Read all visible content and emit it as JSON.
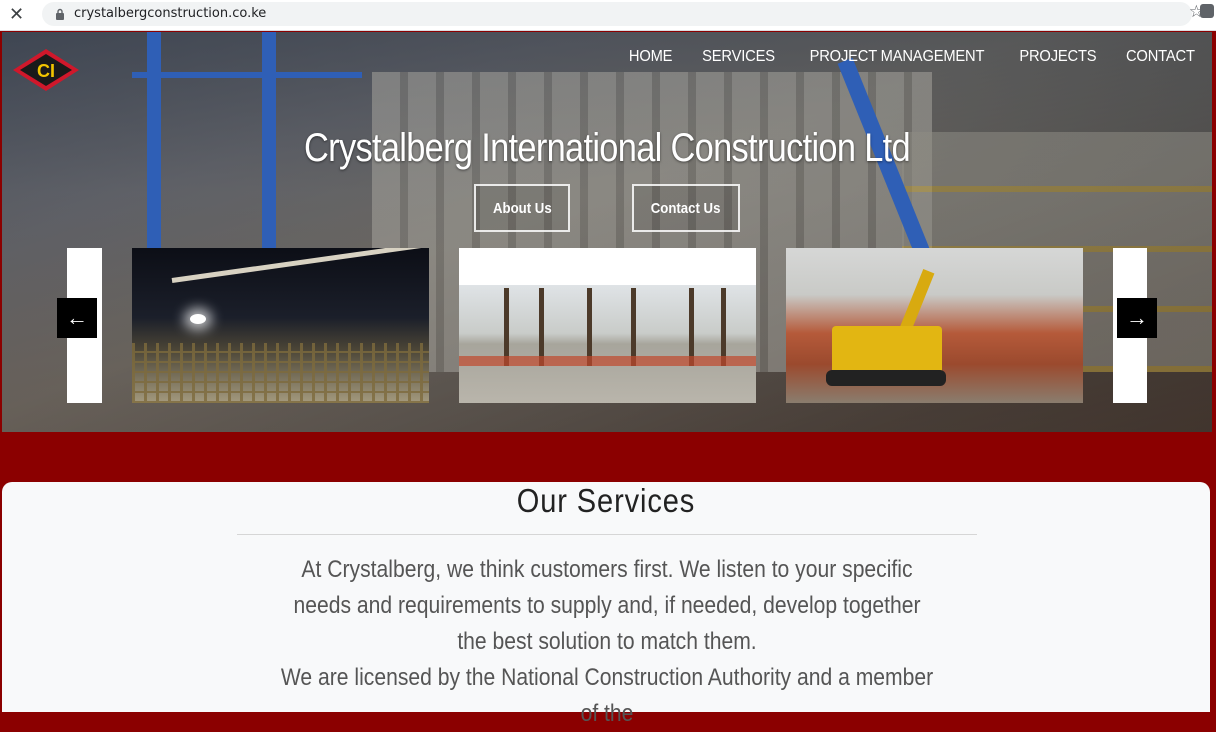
{
  "browser": {
    "url": "crystalbergconstruction.co.ke",
    "close_icon": "close-icon",
    "lock_icon": "lock-icon",
    "star_icon": "star-icon",
    "extension_icon": "puzzle-icon"
  },
  "site": {
    "logo_text": "CI",
    "nav": [
      "HOME",
      "SERVICES",
      "PROJECT MANAGEMENT",
      "PROJECTS",
      "CONTACT"
    ]
  },
  "hero": {
    "title": "Crystalberg International Construction Ltd",
    "about_label": "About Us",
    "contact_label": "Contact Us",
    "prev_arrow": "←",
    "next_arrow": "→"
  },
  "services": {
    "title": "Our Services",
    "paragraph1": "At Crystalberg, we think customers first. We listen to your specific needs and requirements to supply and, if needed, develop together the best solution to match them.",
    "paragraph2": "We are licensed by the National Construction Authority and a member of the"
  },
  "colors": {
    "brand_red": "#8b0000",
    "logo_red": "#d0182b",
    "logo_yellow": "#f2c500",
    "panel_bg": "#f8f9fa"
  }
}
